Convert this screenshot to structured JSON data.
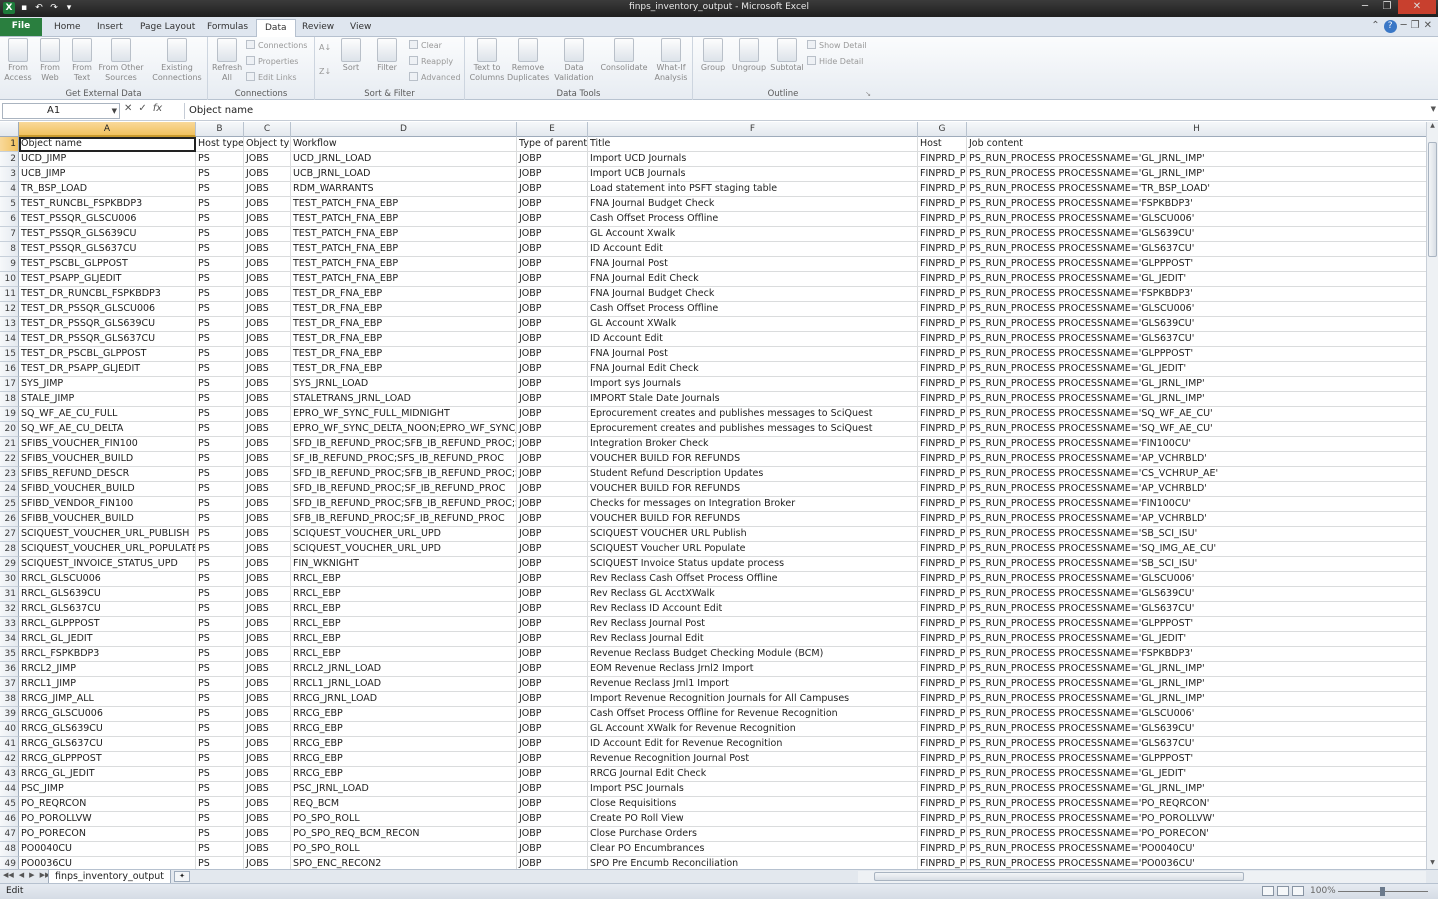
{
  "window": {
    "title": "finps_inventory_output - Microsoft Excel"
  },
  "ribbon_tabs": [
    "File",
    "Home",
    "Insert",
    "Page Layout",
    "Formulas",
    "Data",
    "Review",
    "View"
  ],
  "ribbon": {
    "groups": {
      "get_external": {
        "label": "Get External Data",
        "buttons": [
          "From Access",
          "From Web",
          "From Text",
          "From Other Sources",
          "Existing Connections"
        ]
      },
      "connections": {
        "label": "Connections",
        "refresh": "Refresh All",
        "small": [
          "Connections",
          "Properties",
          "Edit Links"
        ]
      },
      "sort_filter": {
        "label": "Sort & Filter",
        "sort": "Sort",
        "filter": "Filter",
        "small": [
          "Clear",
          "Reapply",
          "Advanced"
        ]
      },
      "data_tools": {
        "label": "Data Tools",
        "buttons": [
          "Text to Columns",
          "Remove Duplicates",
          "Data Validation",
          "Consolidate",
          "What-If Analysis"
        ]
      },
      "outline": {
        "label": "Outline",
        "buttons": [
          "Group",
          "Ungroup",
          "Subtotal"
        ],
        "small": [
          "Show Detail",
          "Hide Detail"
        ]
      }
    }
  },
  "formula_bar": {
    "name_box": "A1",
    "content": "Object name"
  },
  "columns": [
    "A",
    "B",
    "C",
    "D",
    "E",
    "F",
    "G",
    "H"
  ],
  "header_row": [
    "Object name",
    "Host type",
    "Object typ",
    "Workflow",
    "Type of parent",
    "Title",
    "Host",
    "Job content"
  ],
  "rows": [
    [
      "UCD_JIMP",
      "PS",
      "JOBS",
      "UCD_JRNL_LOAD",
      "JOBP",
      "Import UCD Journals",
      "FINPRD_P",
      "PS_RUN_PROCESS PROCESSNAME='GL_JRNL_IMP'"
    ],
    [
      "UCB_JIMP",
      "PS",
      "JOBS",
      "UCB_JRNL_LOAD",
      "JOBP",
      "Import UCB Journals",
      "FINPRD_P",
      "PS_RUN_PROCESS PROCESSNAME='GL_JRNL_IMP'"
    ],
    [
      "TR_BSP_LOAD",
      "PS",
      "JOBS",
      "RDM_WARRANTS",
      "JOBP",
      "Load statement into PSFT staging table",
      "FINPRD_P",
      "PS_RUN_PROCESS PROCESSNAME='TR_BSP_LOAD'"
    ],
    [
      "TEST_RUNCBL_FSPKBDP3",
      "PS",
      "JOBS",
      "TEST_PATCH_FNA_EBP",
      "JOBP",
      "FNA Journal Budget Check",
      "FINPRD_P",
      "PS_RUN_PROCESS PROCESSNAME='FSPKBDP3'"
    ],
    [
      "TEST_PSSQR_GLSCU006",
      "PS",
      "JOBS",
      "TEST_PATCH_FNA_EBP",
      "JOBP",
      "Cash Offset Process Offline",
      "FINPRD_P",
      "PS_RUN_PROCESS PROCESSNAME='GLSCU006'"
    ],
    [
      "TEST_PSSQR_GLS639CU",
      "PS",
      "JOBS",
      "TEST_PATCH_FNA_EBP",
      "JOBP",
      "GL Account Xwalk",
      "FINPRD_P",
      "PS_RUN_PROCESS PROCESSNAME='GLS639CU'"
    ],
    [
      "TEST_PSSQR_GLS637CU",
      "PS",
      "JOBS",
      "TEST_PATCH_FNA_EBP",
      "JOBP",
      "ID Account Edit",
      "FINPRD_P",
      "PS_RUN_PROCESS PROCESSNAME='GLS637CU'"
    ],
    [
      "TEST_PSCBL_GLPPOST",
      "PS",
      "JOBS",
      "TEST_PATCH_FNA_EBP",
      "JOBP",
      "FNA Journal Post",
      "FINPRD_P",
      "PS_RUN_PROCESS PROCESSNAME='GLPPPOST'"
    ],
    [
      "TEST_PSAPP_GLJEDIT",
      "PS",
      "JOBS",
      "TEST_PATCH_FNA_EBP",
      "JOBP",
      "FNA Journal Edit Check",
      "FINPRD_P",
      "PS_RUN_PROCESS PROCESSNAME='GL_JEDIT'"
    ],
    [
      "TEST_DR_RUNCBL_FSPKBDP3",
      "PS",
      "JOBS",
      "TEST_DR_FNA_EBP",
      "JOBP",
      "FNA Journal Budget Check",
      "FINPRD_P",
      "PS_RUN_PROCESS PROCESSNAME='FSPKBDP3'"
    ],
    [
      "TEST_DR_PSSQR_GLSCU006",
      "PS",
      "JOBS",
      "TEST_DR_FNA_EBP",
      "JOBP",
      "Cash Offset Process Offline",
      "FINPRD_P",
      "PS_RUN_PROCESS PROCESSNAME='GLSCU006'"
    ],
    [
      "TEST_DR_PSSQR_GLS639CU",
      "PS",
      "JOBS",
      "TEST_DR_FNA_EBP",
      "JOBP",
      "GL Account XWalk",
      "FINPRD_P",
      "PS_RUN_PROCESS PROCESSNAME='GLS639CU'"
    ],
    [
      "TEST_DR_PSSQR_GLS637CU",
      "PS",
      "JOBS",
      "TEST_DR_FNA_EBP",
      "JOBP",
      "ID Account Edit",
      "FINPRD_P",
      "PS_RUN_PROCESS PROCESSNAME='GLS637CU'"
    ],
    [
      "TEST_DR_PSCBL_GLPPOST",
      "PS",
      "JOBS",
      "TEST_DR_FNA_EBP",
      "JOBP",
      "FNA Journal Post",
      "FINPRD_P",
      "PS_RUN_PROCESS PROCESSNAME='GLPPPOST'"
    ],
    [
      "TEST_DR_PSAPP_GLJEDIT",
      "PS",
      "JOBS",
      "TEST_DR_FNA_EBP",
      "JOBP",
      "FNA Journal Edit Check",
      "FINPRD_P",
      "PS_RUN_PROCESS PROCESSNAME='GL_JEDIT'"
    ],
    [
      "SYS_JIMP",
      "PS",
      "JOBS",
      "SYS_JRNL_LOAD",
      "JOBP",
      "Import sys Journals",
      "FINPRD_P",
      "PS_RUN_PROCESS PROCESSNAME='GL_JRNL_IMP'"
    ],
    [
      "STALE_JIMP",
      "PS",
      "JOBS",
      "STALETRANS_JRNL_LOAD",
      "JOBP",
      "IMPORT Stale Date Journals",
      "FINPRD_P",
      "PS_RUN_PROCESS PROCESSNAME='GL_JRNL_IMP'"
    ],
    [
      "SQ_WF_AE_CU_FULL",
      "PS",
      "JOBS",
      "EPRO_WF_SYNC_FULL_MIDNIGHT",
      "JOBP",
      "Eprocurement creates and publishes messages to SciQuest",
      "FINPRD_P",
      "PS_RUN_PROCESS PROCESSNAME='SQ_WF_AE_CU'"
    ],
    [
      "SQ_WF_AE_CU_DELTA",
      "PS",
      "JOBS",
      "EPRO_WF_SYNC_DELTA_NOON;EPRO_WF_SYNC_",
      "JOBP",
      "Eprocurement creates and publishes messages to SciQuest",
      "FINPRD_P",
      "PS_RUN_PROCESS PROCESSNAME='SQ_WF_AE_CU'"
    ],
    [
      "SFIBS_VOUCHER_FIN100",
      "PS",
      "JOBS",
      "SFD_IB_REFUND_PROC;SFB_IB_REFUND_PROC;SF",
      "JOBP",
      "Integration Broker Check",
      "FINPRD_P",
      "PS_RUN_PROCESS PROCESSNAME='FIN100CU'"
    ],
    [
      "SFIBS_VOUCHER_BUILD",
      "PS",
      "JOBS",
      "SF_IB_REFUND_PROC;SFS_IB_REFUND_PROC",
      "JOBP",
      "VOUCHER BUILD FOR REFUNDS",
      "FINPRD_P",
      "PS_RUN_PROCESS PROCESSNAME='AP_VCHRBLD'"
    ],
    [
      "SFIBS_REFUND_DESCR",
      "PS",
      "JOBS",
      "SFD_IB_REFUND_PROC;SFB_IB_REFUND_PROC;SF",
      "JOBP",
      "Student Refund Description Updates",
      "FINPRD_P",
      "PS_RUN_PROCESS PROCESSNAME='CS_VCHRUP_AE'"
    ],
    [
      "SFIBD_VOUCHER_BUILD",
      "PS",
      "JOBS",
      "SFD_IB_REFUND_PROC;SF_IB_REFUND_PROC",
      "JOBP",
      "VOUCHER BUILD FOR REFUNDS",
      "FINPRD_P",
      "PS_RUN_PROCESS PROCESSNAME='AP_VCHRBLD'"
    ],
    [
      "SFIBD_VENDOR_FIN100",
      "PS",
      "JOBS",
      "SFD_IB_REFUND_PROC;SFB_IB_REFUND_PROC;SF",
      "JOBP",
      "Checks for messages on Integration Broker",
      "FINPRD_P",
      "PS_RUN_PROCESS PROCESSNAME='FIN100CU'"
    ],
    [
      "SFIBB_VOUCHER_BUILD",
      "PS",
      "JOBS",
      "SFB_IB_REFUND_PROC;SF_IB_REFUND_PROC",
      "JOBP",
      "VOUCHER BUILD FOR REFUNDS",
      "FINPRD_P",
      "PS_RUN_PROCESS PROCESSNAME='AP_VCHRBLD'"
    ],
    [
      "SCIQUEST_VOUCHER_URL_PUBLISH",
      "PS",
      "JOBS",
      "SCIQUEST_VOUCHER_URL_UPD",
      "JOBP",
      "SCIQUEST VOUCHER URL Publish",
      "FINPRD_P",
      "PS_RUN_PROCESS PROCESSNAME='SB_SCI_ISU'"
    ],
    [
      "SCIQUEST_VOUCHER_URL_POPULATE",
      "PS",
      "JOBS",
      "SCIQUEST_VOUCHER_URL_UPD",
      "JOBP",
      "SCIQUEST Voucher URL Populate",
      "FINPRD_P",
      "PS_RUN_PROCESS PROCESSNAME='SQ_IMG_AE_CU'"
    ],
    [
      "SCIQUEST_INVOICE_STATUS_UPD",
      "PS",
      "JOBS",
      "FIN_WKNIGHT",
      "JOBP",
      "SCIQUEST Invoice Status update process",
      "FINPRD_P",
      "PS_RUN_PROCESS PROCESSNAME='SB_SCI_ISU'"
    ],
    [
      "RRCL_GLSCU006",
      "PS",
      "JOBS",
      "RRCL_EBP",
      "JOBP",
      "Rev Reclass  Cash Offset Process Offline",
      "FINPRD_P",
      "PS_RUN_PROCESS PROCESSNAME='GLSCU006'"
    ],
    [
      "RRCL_GLS639CU",
      "PS",
      "JOBS",
      "RRCL_EBP",
      "JOBP",
      "Rev Reclass GL AcctXWalk",
      "FINPRD_P",
      "PS_RUN_PROCESS PROCESSNAME='GLS639CU'"
    ],
    [
      "RRCL_GLS637CU",
      "PS",
      "JOBS",
      "RRCL_EBP",
      "JOBP",
      "Rev Reclass ID Account Edit",
      "FINPRD_P",
      "PS_RUN_PROCESS PROCESSNAME='GLS637CU'"
    ],
    [
      "RRCL_GLPPPOST",
      "PS",
      "JOBS",
      "RRCL_EBP",
      "JOBP",
      "Rev Reclass Journal Post",
      "FINPRD_P",
      "PS_RUN_PROCESS PROCESSNAME='GLPPPOST'"
    ],
    [
      "RRCL_GL_JEDIT",
      "PS",
      "JOBS",
      "RRCL_EBP",
      "JOBP",
      "Rev Reclass Journal Edit",
      "FINPRD_P",
      "PS_RUN_PROCESS PROCESSNAME='GL_JEDIT'"
    ],
    [
      "RRCL_FSPKBDP3",
      "PS",
      "JOBS",
      "RRCL_EBP",
      "JOBP",
      "Revenue Reclass Budget Checking Module (BCM)",
      "FINPRD_P",
      "PS_RUN_PROCESS PROCESSNAME='FSPKBDP3'"
    ],
    [
      "RRCL2_JIMP",
      "PS",
      "JOBS",
      "RRCL2_JRNL_LOAD",
      "JOBP",
      "EOM Revenue Reclass Jrnl2 Import",
      "FINPRD_P",
      "PS_RUN_PROCESS PROCESSNAME='GL_JRNL_IMP'"
    ],
    [
      "RRCL1_JIMP",
      "PS",
      "JOBS",
      "RRCL1_JRNL_LOAD",
      "JOBP",
      "Revenue Reclass Jrnl1 Import",
      "FINPRD_P",
      "PS_RUN_PROCESS PROCESSNAME='GL_JRNL_IMP'"
    ],
    [
      "RRCG_JIMP_ALL",
      "PS",
      "JOBS",
      "RRCG_JRNL_LOAD",
      "JOBP",
      "Import Revenue Recognition Journals for All Campuses",
      "FINPRD_P",
      "PS_RUN_PROCESS PROCESSNAME='GL_JRNL_IMP'"
    ],
    [
      "RRCG_GLSCU006",
      "PS",
      "JOBS",
      "RRCG_EBP",
      "JOBP",
      "Cash Offset Process Offline for Revenue Recognition",
      "FINPRD_P",
      "PS_RUN_PROCESS PROCESSNAME='GLSCU006'"
    ],
    [
      "RRCG_GLS639CU",
      "PS",
      "JOBS",
      "RRCG_EBP",
      "JOBP",
      "GL Account XWalk  for Revenue Recognition",
      "FINPRD_P",
      "PS_RUN_PROCESS PROCESSNAME='GLS639CU'"
    ],
    [
      "RRCG_GLS637CU",
      "PS",
      "JOBS",
      "RRCG_EBP",
      "JOBP",
      "ID Account Edit  for Revenue Recognition",
      "FINPRD_P",
      "PS_RUN_PROCESS PROCESSNAME='GLS637CU'"
    ],
    [
      "RRCG_GLPPPOST",
      "PS",
      "JOBS",
      "RRCG_EBP",
      "JOBP",
      "Revenue Recognition Journal Post",
      "FINPRD_P",
      "PS_RUN_PROCESS PROCESSNAME='GLPPPOST'"
    ],
    [
      "RRCG_GL_JEDIT",
      "PS",
      "JOBS",
      "RRCG_EBP",
      "JOBP",
      "RRCG Journal Edit Check",
      "FINPRD_P",
      "PS_RUN_PROCESS PROCESSNAME='GL_JEDIT'"
    ],
    [
      "PSC_JIMP",
      "PS",
      "JOBS",
      "PSC_JRNL_LOAD",
      "JOBP",
      "Import  PSC Journals",
      "FINPRD_P",
      "PS_RUN_PROCESS PROCESSNAME='GL_JRNL_IMP'"
    ],
    [
      "PO_REQRCON",
      "PS",
      "JOBS",
      "REQ_BCM",
      "JOBP",
      "Close Requisitions",
      "FINPRD_P",
      "PS_RUN_PROCESS PROCESSNAME='PO_REQRCON'"
    ],
    [
      "PO_POROLLVW",
      "PS",
      "JOBS",
      "PO_SPO_ROLL",
      "JOBP",
      "Create PO Roll View",
      "FINPRD_P",
      "PS_RUN_PROCESS PROCESSNAME='PO_POROLLVW'"
    ],
    [
      "PO_PORECON",
      "PS",
      "JOBS",
      "PO_SPO_REQ_BCM_RECON",
      "JOBP",
      "Close Purchase Orders",
      "FINPRD_P",
      "PS_RUN_PROCESS PROCESSNAME='PO_PORECON'"
    ],
    [
      "PO0040CU",
      "PS",
      "JOBS",
      "PO_SPO_ROLL",
      "JOBP",
      "Clear PO Encumbrances",
      "FINPRD_P",
      "PS_RUN_PROCESS PROCESSNAME='PO0040CU'"
    ],
    [
      "PO0036CU",
      "PS",
      "JOBS",
      "SPO_ENC_RECON2",
      "JOBP",
      "SPO Pre Encumb Reconciliation",
      "FINPRD_P",
      "PS_RUN_PROCESS PROCESSNAME='PO0036CU'"
    ]
  ],
  "sheet_tabs": [
    "finps_inventory_output"
  ],
  "status": {
    "mode": "Edit",
    "zoom": "100%"
  }
}
